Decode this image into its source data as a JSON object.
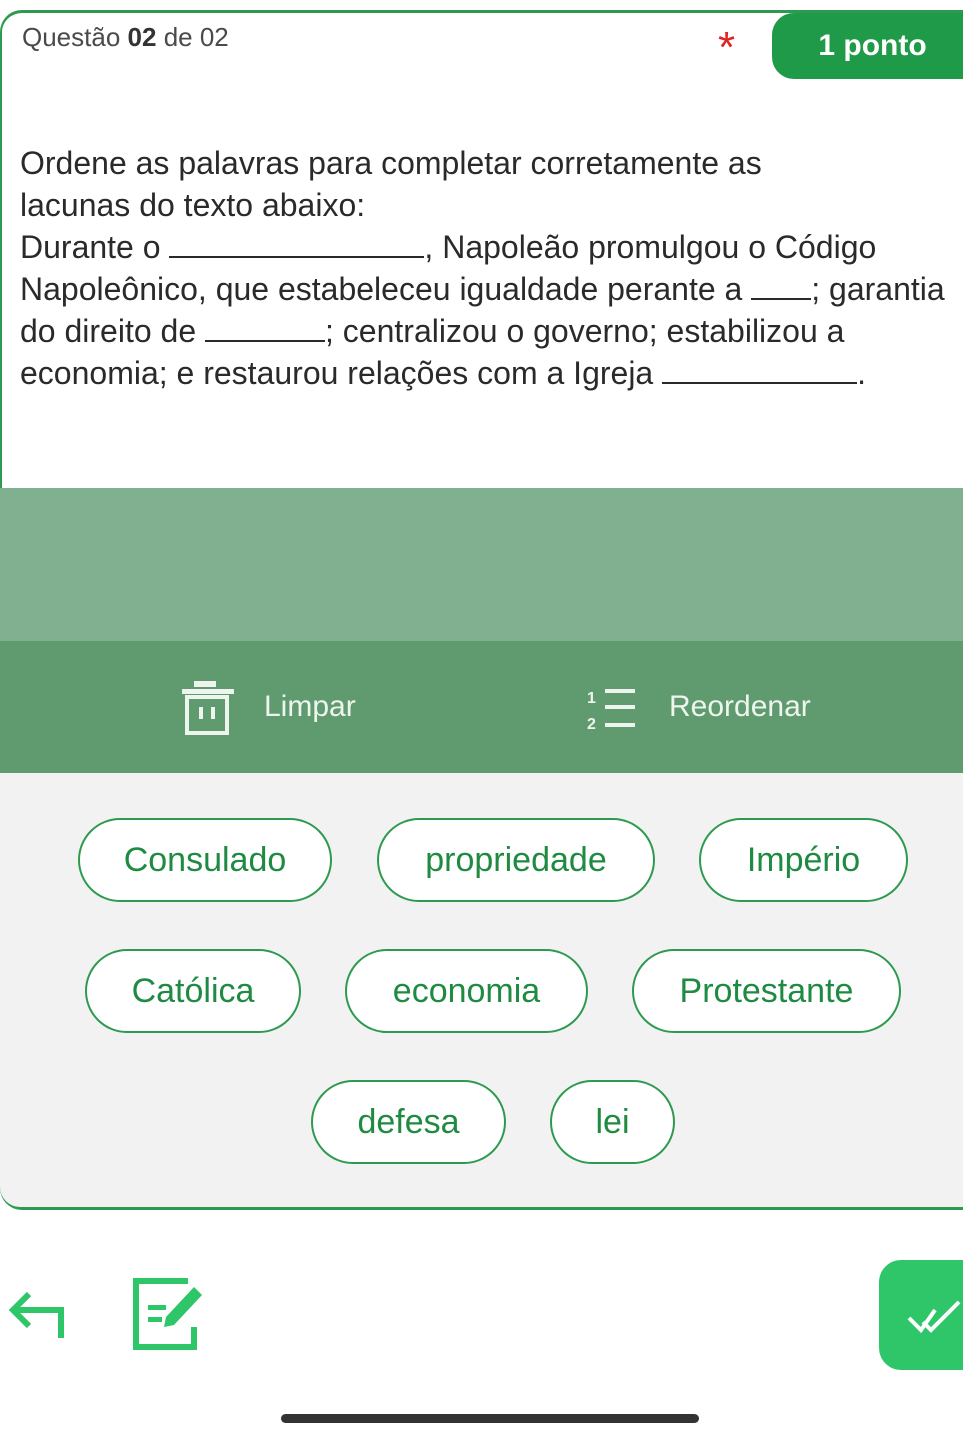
{
  "header": {
    "question_label": "Questão",
    "question_number": "02",
    "question_of": "de 02",
    "required_mark": "*",
    "points": "1 ponto"
  },
  "question": {
    "instruction_line1": "Ordene as palavras para completar corretamente as",
    "instruction_line2": "lacunas do texto abaixo:",
    "seg1": "Durante o ",
    "seg2": ", Napoleão promulgou o Código Napoleônico, que estabeleceu igualdade perante a ",
    "seg3": "; garantia do direito de ",
    "seg4": "; centralizou o governo; estabilizou a economia; e restaurou relações com a Igreja ",
    "seg5": "."
  },
  "toolbar": {
    "clear_label": "Limpar",
    "reorder_label": "Reordenar",
    "clear_icon": "trash-icon",
    "reorder_icon": "numbered-list-icon"
  },
  "word_bank": [
    "Consulado",
    "propriedade",
    "Império",
    "Católica",
    "economia",
    "Protestante",
    "defesa",
    "lei"
  ],
  "nav": {
    "back_icon": "back-arrow-icon",
    "edit_icon": "edit-note-icon",
    "submit_icon": "double-check-icon"
  },
  "colors": {
    "accent": "#1f9a48",
    "answer_zone": "#80b08f",
    "toolbar": "#609b70",
    "submit": "#2fc66a",
    "required": "#e02424"
  }
}
